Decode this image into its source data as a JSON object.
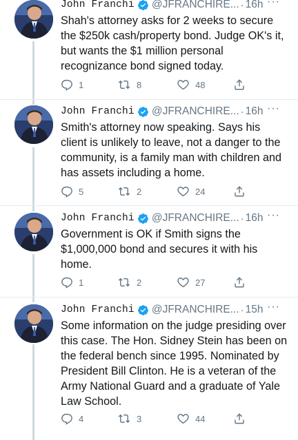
{
  "tweets": [
    {
      "author": "John Franchi",
      "handle": "@JFRANCHIRE...",
      "time": "16h",
      "more": "···",
      "text": "Shah's attorney asks for 2 weeks to secure the $250k cash/property bond.  Judge OK's it, but wants the $1 million personal recognizance bond signed today.",
      "replies": "1",
      "retweets": "8",
      "likes": "48"
    },
    {
      "author": "John Franchi",
      "handle": "@JFRANCHIRE...",
      "time": "16h",
      "more": "···",
      "text": "Smith's attorney now speaking.  Says his client is unlikely to leave, not a danger to the community, is a family man with children and has assets including a home.",
      "replies": "5",
      "retweets": "2",
      "likes": "24"
    },
    {
      "author": "John Franchi",
      "handle": "@JFRANCHIRE...",
      "time": "16h",
      "more": "···",
      "text": "Government is OK if Smith signs the $1,000,000 bond and secures it with his home.",
      "replies": "1",
      "retweets": "2",
      "likes": "27"
    },
    {
      "author": "John Franchi",
      "handle": "@JFRANCHIRE...",
      "time": "15h",
      "more": "···",
      "text": "Some information on the judge presiding over this case.  The Hon. Sidney Stein has been on the federal bench since 1995.  Nominated by President Bill Clinton.  He is a veteran of the Army National Guard and a graduate of Yale Law School.",
      "replies": "4",
      "retweets": "3",
      "likes": "44"
    }
  ],
  "colors": {
    "text": "#14171a",
    "muted": "#657786",
    "verified": "#1da1f2",
    "divider": "#e6ecf0",
    "thread": "#cfd9de"
  }
}
